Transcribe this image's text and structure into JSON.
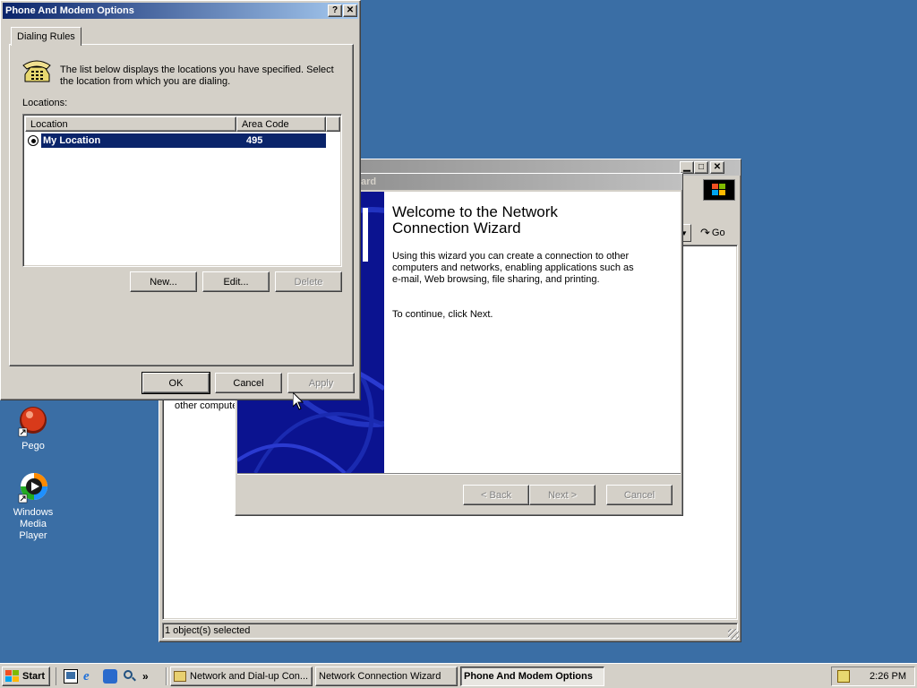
{
  "desktop": {
    "icons": [
      {
        "label": "Pego"
      },
      {
        "label": "Windows Media Player"
      }
    ]
  },
  "explorer": {
    "go_label": "Go",
    "content_snippet": "other compute",
    "status": "1 object(s) selected"
  },
  "wizard": {
    "title_fragment": "ard",
    "heading": "Welcome to the Network Connection Wizard",
    "body": "Using this wizard you can create a connection to other computers and networks, enabling applications such as e-mail, Web browsing, file sharing, and printing.",
    "continue": "To continue, click Next.",
    "back_label": "< Back",
    "next_label": "Next >",
    "cancel_label": "Cancel"
  },
  "phone": {
    "title": "Phone And Modem Options",
    "help_glyph": "?",
    "close_glyph": "✕",
    "tab": "Dialing Rules",
    "intro": "The list below displays the locations you have specified. Select the location from which you are dialing.",
    "locations_label": "Locations:",
    "columns": [
      "Location",
      "Area Code"
    ],
    "rows": [
      {
        "location": "My Location",
        "area_code": "495"
      }
    ],
    "new_label": "New...",
    "edit_label": "Edit...",
    "delete_label": "Delete",
    "ok_label": "OK",
    "cancel_label": "Cancel",
    "apply_label": "Apply"
  },
  "taskbar": {
    "start_label": "Start",
    "chevron": "»",
    "tasks": [
      {
        "label": "Network and Dial-up Con..."
      },
      {
        "label": "Network Connection Wizard"
      },
      {
        "label": "Phone And Modem Options"
      }
    ],
    "clock": "2:26 PM"
  },
  "colors": {
    "desktop": "#3a6ea5",
    "title_active": "#0a246a",
    "title_inactive": "#808080",
    "selection": "#0a246a",
    "face": "#d4d0c8"
  }
}
